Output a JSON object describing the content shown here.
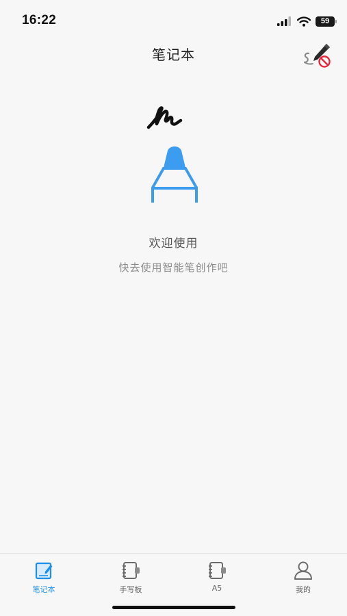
{
  "status_bar": {
    "time": "16:22",
    "battery": "59",
    "icons": [
      "cellular-signal-icon",
      "wifi-icon",
      "battery-icon"
    ]
  },
  "nav": {
    "title": "笔记本",
    "action_icon": "pen-disabled-icon"
  },
  "empty_state": {
    "illustration_icon": "smart-pen-icon",
    "title": "欢迎使用",
    "subtitle": "快去使用智能笔创作吧"
  },
  "tab_bar": {
    "tabs": [
      {
        "label": "笔记本",
        "icon": "notebook-icon",
        "active": true
      },
      {
        "label": "手写板",
        "icon": "handwriting-board-icon",
        "active": false
      },
      {
        "label": "A5",
        "icon": "a5-notebook-icon",
        "active": false
      },
      {
        "label": "我的",
        "icon": "profile-icon",
        "active": false
      }
    ]
  },
  "colors": {
    "accent": "#1f8fea",
    "pen_blue": "#3b9cf0",
    "background": "#f7f7f7",
    "muted_text": "#8c8c8c",
    "disabled_red": "#e8243c"
  }
}
